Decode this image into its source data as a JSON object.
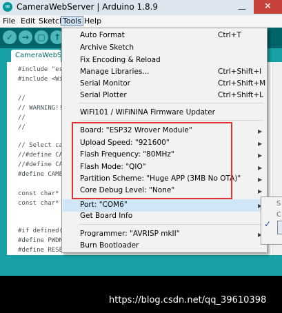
{
  "window": {
    "title": "CameraWebServer | Arduino 1.8.9",
    "minimize_glyph": "—",
    "close_glyph": "✕"
  },
  "menubar": [
    "File",
    "Edit",
    "Sketch",
    "Tools",
    "Help"
  ],
  "toolbar": {
    "verify": "✓",
    "upload": "→",
    "new": "▢",
    "open": "↑",
    "save": "↓"
  },
  "tab": {
    "label": "CameraWebSe"
  },
  "code_lines": [
    "#include \"esp",
    "#include <WiFi",
    "",
    "//",
    "// WARNING!!!",
    "//",
    "//",
    "",
    "// Select cam",
    "//#define CAM",
    "//#define CAM",
    "#define CAMER",
    "",
    "const char* s",
    "const char* p",
    "",
    "",
    "#if defined(C",
    "#define PWDN_",
    "#define RESET"
  ],
  "tools_menu": {
    "items": [
      {
        "label": "Auto Format",
        "shortcut": "Ctrl+T"
      },
      {
        "label": "Archive Sketch",
        "shortcut": ""
      },
      {
        "label": "Fix Encoding & Reload",
        "shortcut": ""
      },
      {
        "label": "Manage Libraries...",
        "shortcut": "Ctrl+Shift+I"
      },
      {
        "label": "Serial Monitor",
        "shortcut": "Ctrl+Shift+M"
      },
      {
        "label": "Serial Plotter",
        "shortcut": "Ctrl+Shift+L"
      },
      {
        "label": "WiFi101 / WiFiNINA Firmware Updater",
        "shortcut": ""
      },
      {
        "label": "Board: \"ESP32 Wrover Module\"",
        "submenu": true
      },
      {
        "label": "Upload Speed: \"921600\"",
        "submenu": true
      },
      {
        "label": "Flash Frequency: \"80MHz\"",
        "submenu": true
      },
      {
        "label": "Flash Mode: \"QIO\"",
        "submenu": true
      },
      {
        "label": "Partition Scheme: \"Huge APP (3MB No OTA)\"",
        "submenu": true
      },
      {
        "label": "Core Debug Level: \"None\"",
        "submenu": true
      },
      {
        "label": "Port: \"COM6\"",
        "submenu": true
      },
      {
        "label": "Get Board Info",
        "shortcut": ""
      },
      {
        "label": "Programmer: \"AVRISP mkII\"",
        "submenu": true
      },
      {
        "label": "Burn Bootloader",
        "shortcut": ""
      }
    ],
    "submenu_arrow": "▶"
  },
  "port_submenu": {
    "items": [
      "S",
      "C"
    ],
    "checked": "✓"
  },
  "watermark": "https://blog.csdn.net/qq_39610398",
  "colors": {
    "accent_teal": "#17a1a5",
    "toolbar_teal": "#006468",
    "highlight_red": "#e03030",
    "menu_highlight": "#d0e6f7"
  }
}
